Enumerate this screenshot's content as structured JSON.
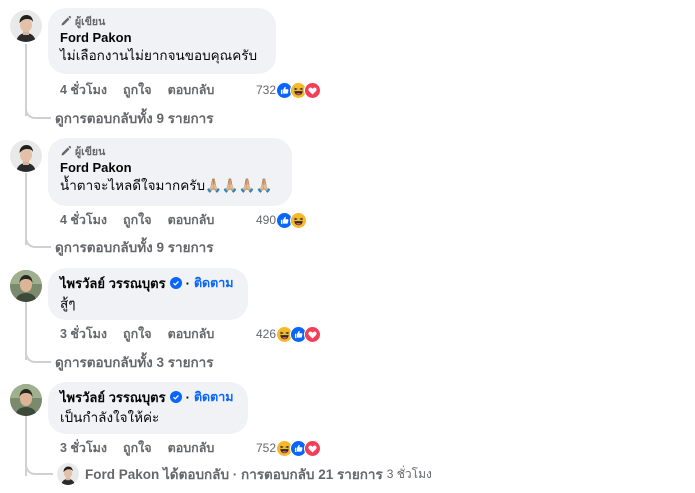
{
  "comments": [
    {
      "author_badge": "ผู้เขียน",
      "name": "Ford Pakon",
      "text": "ไม่เลือกงานไม่ยากจนขอบคุณครับ",
      "time": "4 ชั่วโมง",
      "like": "ถูกใจ",
      "reply": "ตอบกลับ",
      "reaction_count": "732",
      "reactions": [
        "like-icon",
        "haha-icon",
        "love-icon"
      ],
      "view_replies": "ดูการตอบกลับทั้ง 9 รายการ"
    },
    {
      "author_badge": "ผู้เขียน",
      "name": "Ford Pakon",
      "text": "น้ำตาจะไหลดีใจมากครับ🙏🏼🙏🏼🙏🏼🙏🏼",
      "time": "4 ชั่วโมง",
      "like": "ถูกใจ",
      "reply": "ตอบกลับ",
      "reaction_count": "490",
      "reactions": [
        "like-icon",
        "haha-icon"
      ],
      "view_replies": "ดูการตอบกลับทั้ง 9 รายการ"
    },
    {
      "name": "ไพรวัลย์ วรรณบุตร",
      "follow": "ติดตาม",
      "dot": "·",
      "text": "สู้ๆ",
      "time": "3 ชั่วโมง",
      "like": "ถูกใจ",
      "reply": "ตอบกลับ",
      "reaction_count": "426",
      "reactions": [
        "haha-icon",
        "like-icon",
        "love-icon"
      ],
      "view_replies": "ดูการตอบกลับทั้ง 3 รายการ"
    },
    {
      "name": "ไพรวัลย์ วรรณบุตร",
      "follow": "ติดตาม",
      "dot": "·",
      "text": "เป็นกำลังใจให้ค่ะ",
      "time": "3 ชั่วโมง",
      "like": "ถูกใจ",
      "reply": "ตอบกลับ",
      "reaction_count": "752",
      "reactions": [
        "haha-icon",
        "like-icon",
        "love-icon"
      ]
    }
  ],
  "last_reply": {
    "text": "Ford Pakon ได้ตอบกลับ · การตอบกลับ 21 รายการ",
    "ago": "3 ชั่วโมง"
  },
  "colors": {
    "bubble": "#f0f2f5",
    "link_blue": "#0866ff",
    "secondary_text": "#65676b",
    "like": "#0866ff",
    "love": "#f33e58",
    "haha": "#f7b928"
  }
}
